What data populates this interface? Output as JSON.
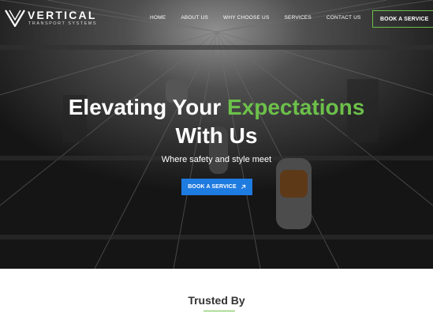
{
  "brand": {
    "name": "VERTICAL",
    "sub": "TRANSPORT SYSTEMS"
  },
  "nav": {
    "items": [
      {
        "label": "HOME"
      },
      {
        "label": "ABOUT US"
      },
      {
        "label": "WHY CHOOSE US"
      },
      {
        "label": "SERVICES"
      },
      {
        "label": "CONTACT US"
      }
    ],
    "book_label": "BOOK A SERVICE"
  },
  "hero": {
    "title_part1": "Elevating Your",
    "title_accent": "Expectations",
    "title_line2": "With Us",
    "tagline": "Where safety and style meet",
    "cta_label": "BOOK A SERVICE",
    "accent_color": "#6cc04a",
    "cta_color": "#1e7be0"
  },
  "trusted": {
    "heading": "Trusted By"
  },
  "icons": {
    "logo": "vertical-v-logo-icon",
    "cta": "arrow-up-right-icon"
  }
}
